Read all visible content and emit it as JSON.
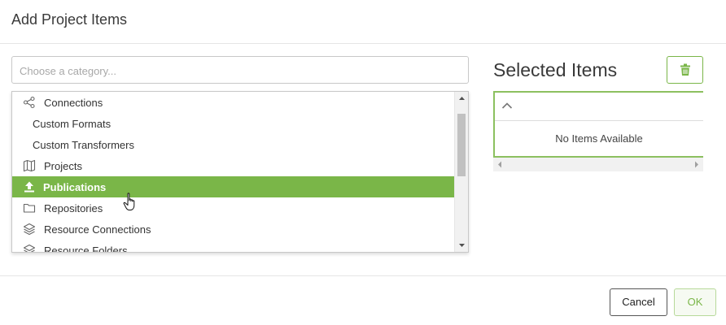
{
  "dialog": {
    "title": "Add Project Items"
  },
  "category": {
    "placeholder": "Choose a category..."
  },
  "dropdown": {
    "items": [
      {
        "label": "Connections",
        "icon": "share-icon"
      },
      {
        "label": "Custom Formats",
        "icon": ""
      },
      {
        "label": "Custom Transformers",
        "icon": ""
      },
      {
        "label": "Projects",
        "icon": "map-icon"
      },
      {
        "label": "Publications",
        "icon": "upload-icon",
        "selected": true
      },
      {
        "label": "Repositories",
        "icon": "folder-icon"
      },
      {
        "label": "Resource Connections",
        "icon": "layers-icon"
      },
      {
        "label": "Resource Folders",
        "icon": "layers-icon"
      }
    ]
  },
  "selected_panel": {
    "title": "Selected Items",
    "empty_text": "No Items Available"
  },
  "footer": {
    "cancel_label": "Cancel",
    "ok_label": "OK"
  },
  "colors": {
    "accent": "#7ab648",
    "selected_text": "#ffffff"
  }
}
